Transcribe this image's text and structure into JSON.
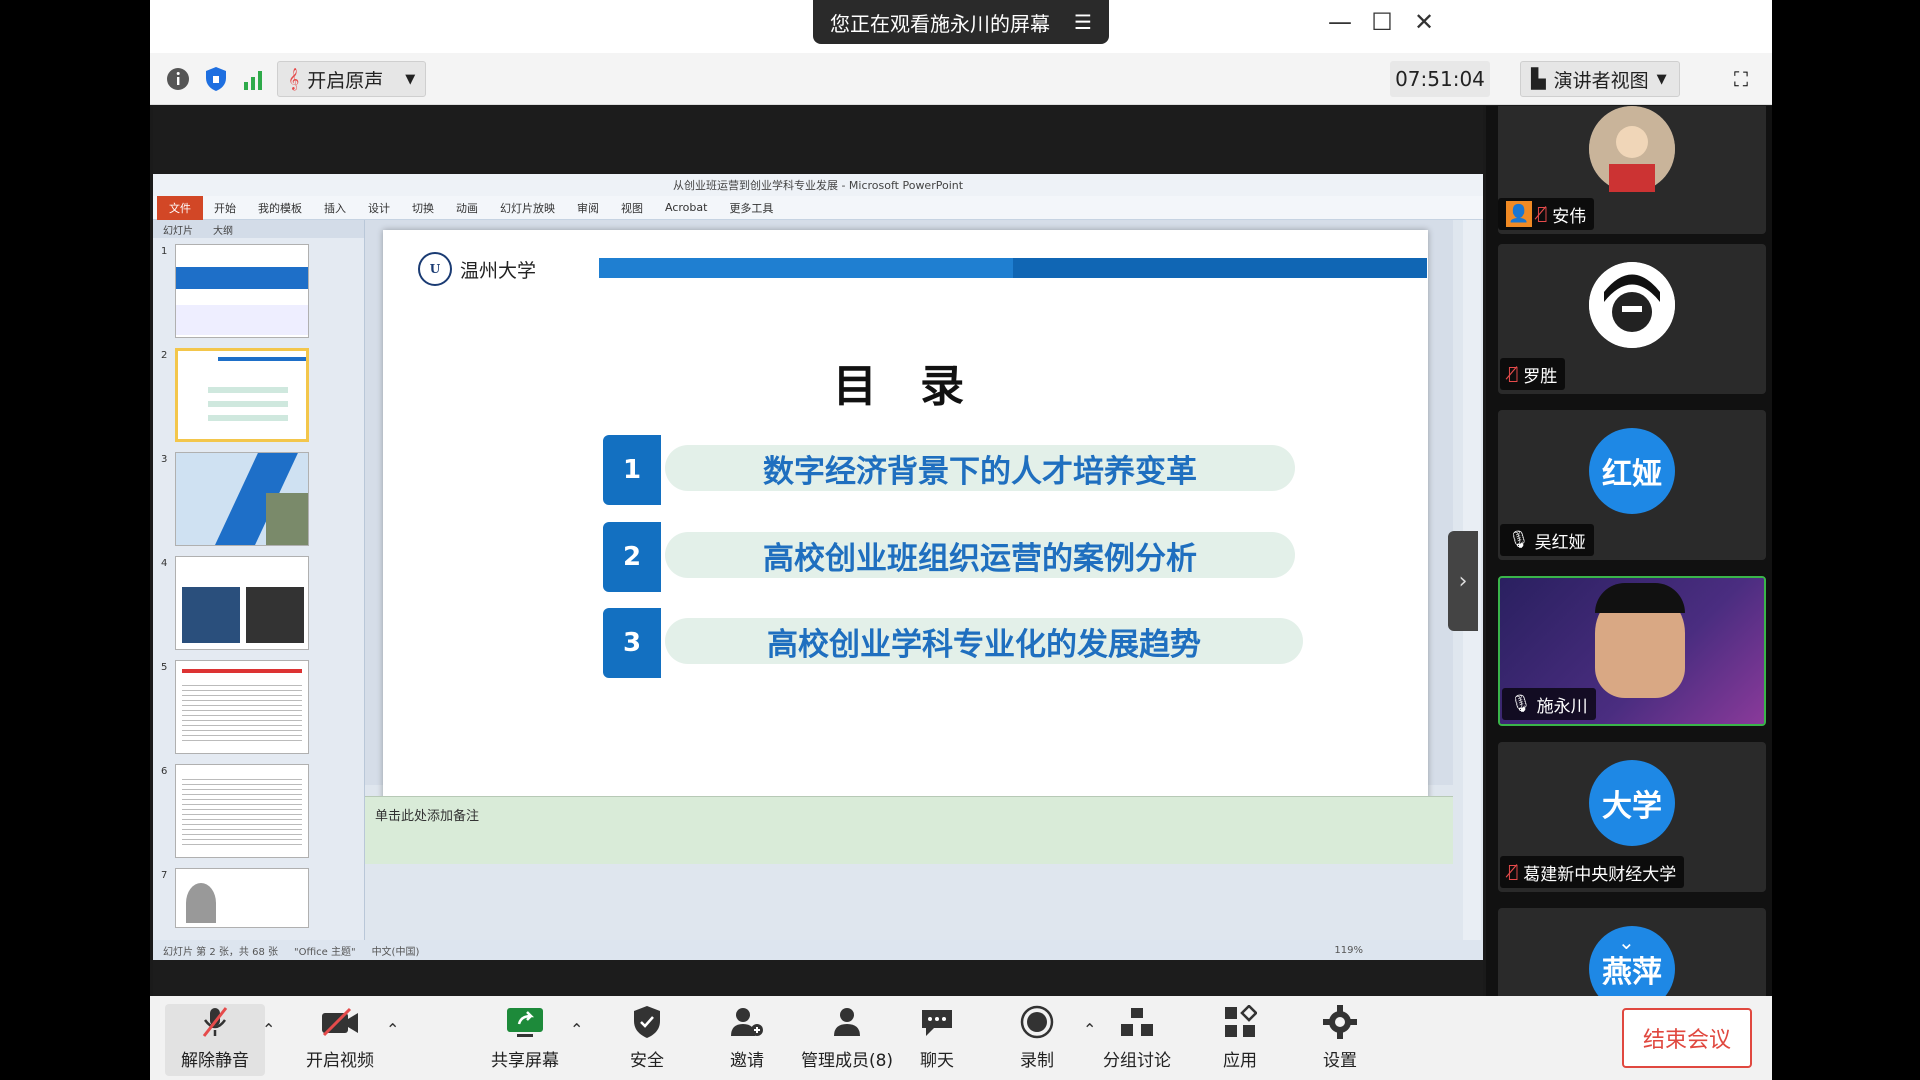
{
  "banner": {
    "text": "您正在观看施永川的屏幕",
    "menu_icon": "list-icon"
  },
  "toolbar": {
    "original_sound_label": "开启原声",
    "timer": "07:51:04",
    "view_label": "演讲者视图"
  },
  "ppt": {
    "title": "从创业班运营到创业学科专业发展 - Microsoft PowerPoint",
    "menu": [
      "文件",
      "开始",
      "我的模板",
      "插入",
      "设计",
      "切换",
      "动画",
      "幻灯片放映",
      "审阅",
      "视图",
      "Acrobat",
      "更多工具"
    ],
    "panel_tabs": [
      "幻灯片",
      "大纲"
    ],
    "thumb_numbers": [
      "1",
      "2",
      "3",
      "4",
      "5",
      "6",
      "7"
    ],
    "notes_placeholder": "单击此处添加备注",
    "status": {
      "slide": "幻灯片 第 2 张，共 68 张",
      "theme": "\"Office 主题\"",
      "lang": "中文(中国)",
      "zoom": "119%"
    }
  },
  "slide": {
    "logo_text": "温州大学",
    "logo_seal": "U",
    "heading": "目 录",
    "items": [
      {
        "num": "1",
        "text": "数字经济背景下的人才培养变革"
      },
      {
        "num": "2",
        "text": "高校创业班组织运营的案例分析"
      },
      {
        "num": "3",
        "text": "高校创业学科专业化的发展趋势"
      }
    ]
  },
  "participants": [
    {
      "name": "安伟",
      "avatar_text": "",
      "avatar_color": "#8a8a8a",
      "mic": "muted"
    },
    {
      "name": "罗胜",
      "avatar_text": "",
      "avatar_color": "#ffffff",
      "mic": "muted"
    },
    {
      "name": "吴红娅",
      "avatar_text": "红娅",
      "avatar_color": "#1e88e5",
      "mic": "on"
    },
    {
      "name": "施永川",
      "avatar_text": "",
      "avatar_color": "#3a2a6b",
      "mic": "on"
    },
    {
      "name": "葛建新中央财经大学",
      "avatar_text": "大学",
      "avatar_color": "#1e88e5",
      "mic": "muted"
    },
    {
      "name": "",
      "avatar_text": "燕萍",
      "avatar_color": "#1e88e5",
      "mic": ""
    }
  ],
  "bottom": {
    "unmute": "解除静音",
    "video": "开启视频",
    "share": "共享屏幕",
    "security": "安全",
    "invite": "邀请",
    "members": "管理成员(8)",
    "chat": "聊天",
    "record": "录制",
    "breakout": "分组讨论",
    "apps": "应用",
    "settings": "设置",
    "end": "结束会议"
  }
}
